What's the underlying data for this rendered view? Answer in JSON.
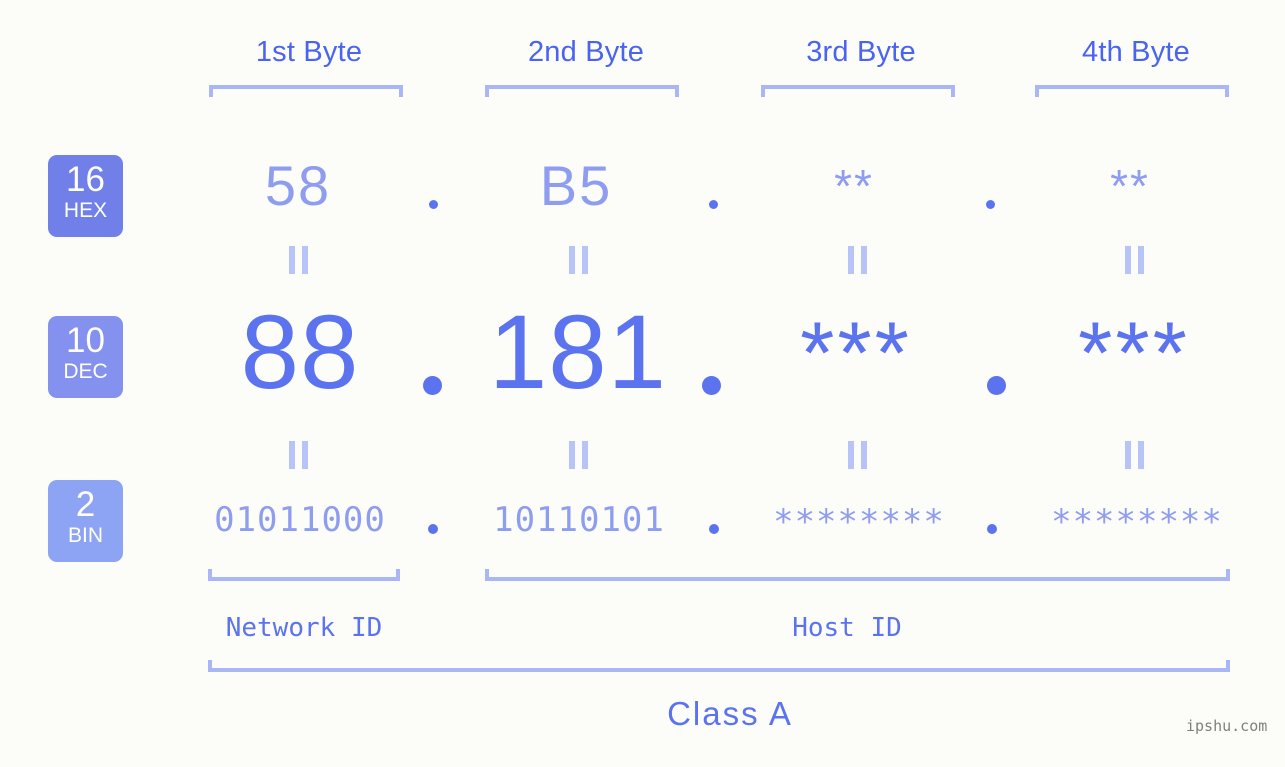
{
  "meta": {
    "watermark": "ipshu.com",
    "background": "#fcfdf8",
    "accent_strong": "#5b73ef",
    "accent_mid": "#8e9df0",
    "accent_light": "#aab7f7",
    "badge_hex_color": "#7180e8",
    "badge_dec_color": "#8491ee",
    "badge_bin_color": "#8da4f5"
  },
  "byte_headers": [
    {
      "label": "1st Byte"
    },
    {
      "label": "2nd Byte"
    },
    {
      "label": "3rd Byte"
    },
    {
      "label": "4th Byte"
    }
  ],
  "radix_badges": [
    {
      "number": "16",
      "name": "HEX"
    },
    {
      "number": "10",
      "name": "DEC"
    },
    {
      "number": "2",
      "name": "BIN"
    }
  ],
  "rows": {
    "hex": {
      "octets": [
        "58",
        "B5",
        "**",
        "**"
      ]
    },
    "dec": {
      "octets": [
        "88",
        "181",
        "***",
        "***"
      ]
    },
    "bin": {
      "octets": [
        "01011000",
        "10110101",
        "********",
        "********"
      ]
    }
  },
  "separator": ".",
  "equality_mark": "||",
  "id_groups": [
    {
      "label": "Network ID"
    },
    {
      "label": "Host ID"
    }
  ],
  "class_label": "Class A"
}
